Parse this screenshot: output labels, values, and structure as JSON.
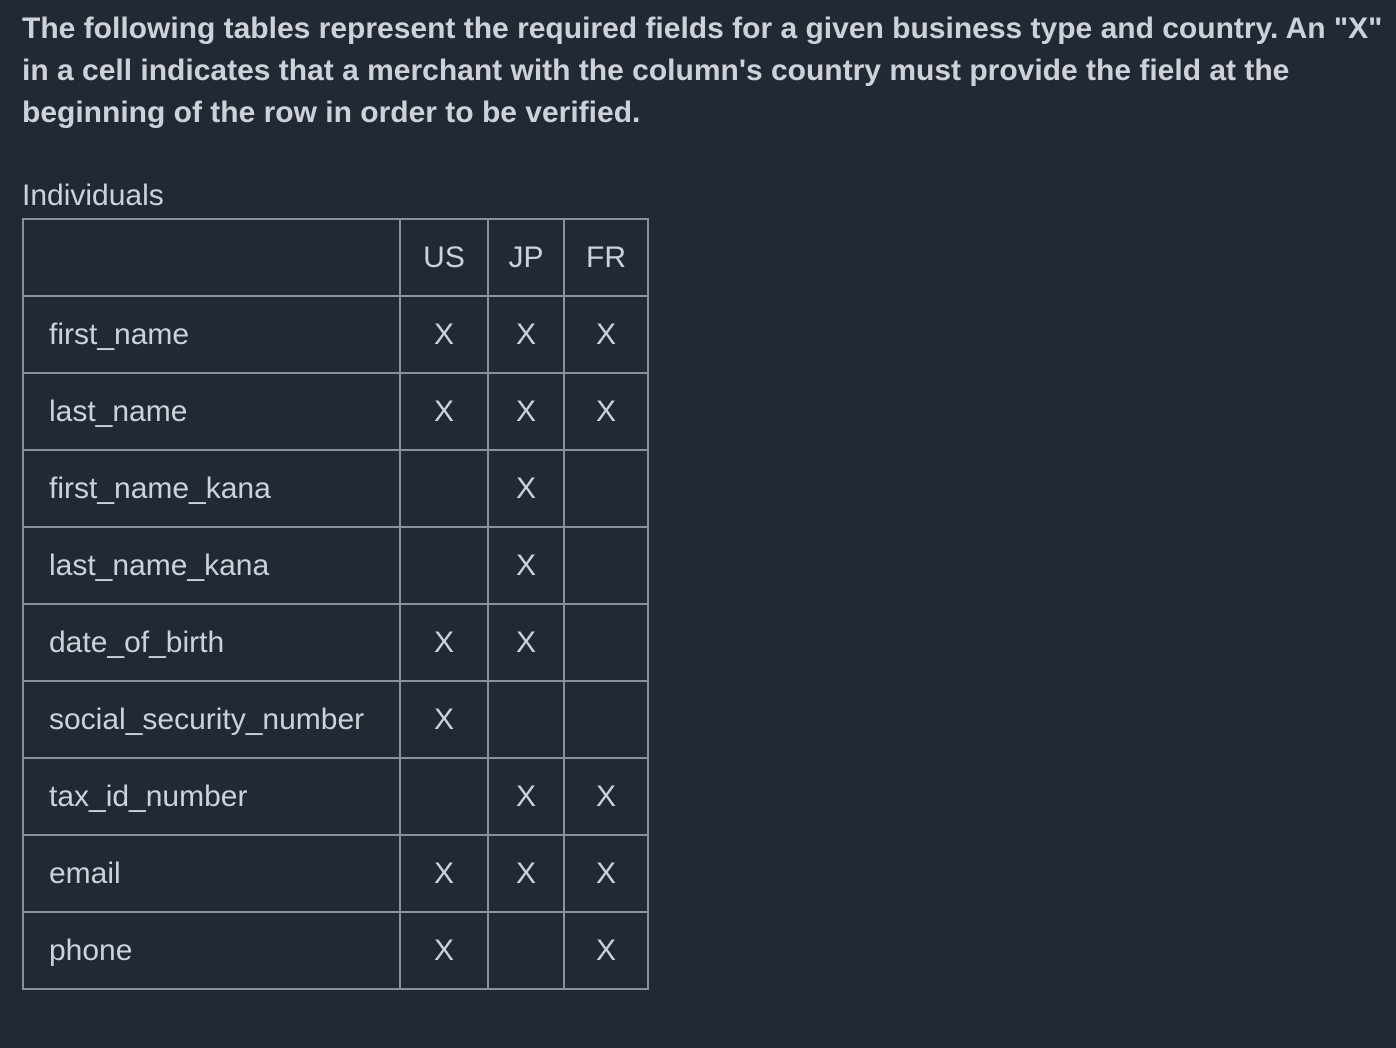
{
  "intro": "The following tables represent the required fields for a given business type and country. An \"X\" in a cell indicates that a merchant with the column's country must provide the field at the beginning of the row in order to be verified.",
  "section_title": "Individuals",
  "table": {
    "columns": [
      "",
      "US",
      "JP",
      "FR"
    ],
    "rows": [
      {
        "field": "first_name",
        "us": "X",
        "jp": "X",
        "fr": "X"
      },
      {
        "field": "last_name",
        "us": "X",
        "jp": "X",
        "fr": "X"
      },
      {
        "field": "first_name_kana",
        "us": "",
        "jp": "X",
        "fr": ""
      },
      {
        "field": "last_name_kana",
        "us": "",
        "jp": "X",
        "fr": ""
      },
      {
        "field": "date_of_birth",
        "us": "X",
        "jp": "X",
        "fr": ""
      },
      {
        "field": "social_security_number",
        "us": "X",
        "jp": "",
        "fr": ""
      },
      {
        "field": "tax_id_number",
        "us": "",
        "jp": "X",
        "fr": "X"
      },
      {
        "field": "email",
        "us": "X",
        "jp": "X",
        "fr": "X"
      },
      {
        "field": "phone",
        "us": "X",
        "jp": "",
        "fr": "X"
      }
    ]
  }
}
